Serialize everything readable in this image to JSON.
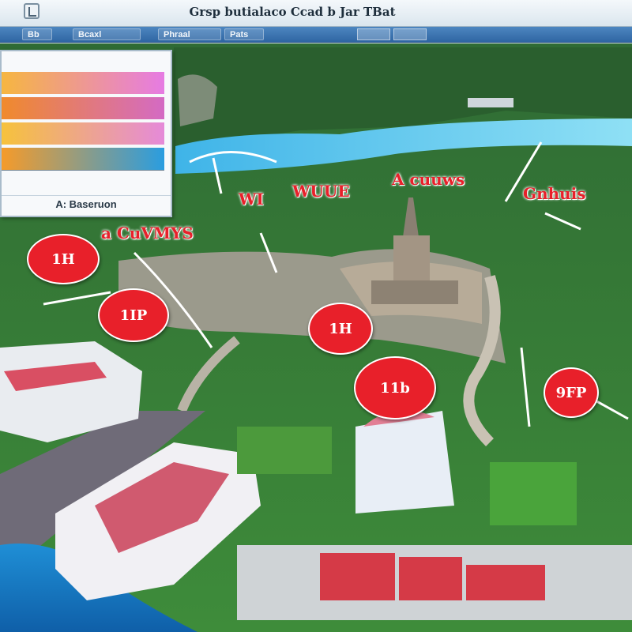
{
  "window": {
    "title": "Grsp butialaco Ccad b Jar TBat"
  },
  "toolbar": {
    "items": [
      "Bb",
      "Bcaxl",
      "Phraal",
      "Pats"
    ]
  },
  "legend": {
    "caption": "A: Baseruon",
    "bars": [
      {
        "from": "#f6b640",
        "to": "#e67be3"
      },
      {
        "from": "#f08a2c",
        "to": "#d46ac4"
      },
      {
        "from": "#f6c23c",
        "to": "#e58ad9"
      },
      {
        "from": "#f59b2a",
        "to": "#2a9de0"
      }
    ]
  },
  "markers": [
    {
      "label": "1H"
    },
    {
      "label": "1IP"
    },
    {
      "label": "1H"
    },
    {
      "label": "11b"
    },
    {
      "label": "9FP"
    }
  ],
  "labels": [
    {
      "text": "WI"
    },
    {
      "text": "WUUE"
    },
    {
      "text": "A cuuws"
    },
    {
      "text": "Gnhuis"
    },
    {
      "text": "a CuVMYS"
    }
  ],
  "colors": {
    "marker": "#e8202a",
    "label": "#e8202a",
    "toolbar": "#3a74b2"
  }
}
